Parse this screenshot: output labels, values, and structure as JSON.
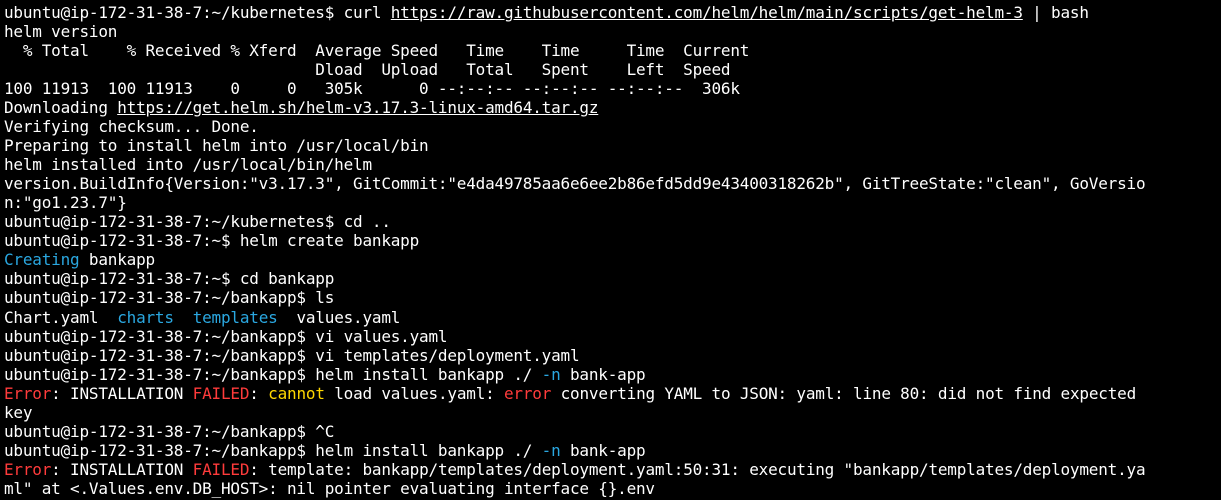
{
  "terminal": {
    "lines": [
      [
        {
          "t": "ubuntu@ip-172-31-38-7:~/kubernetes$ curl "
        },
        {
          "t": "https://raw.githubusercontent.com/helm/helm/main/scripts/get-helm-3",
          "c": "url"
        },
        {
          "t": " | bash"
        }
      ],
      [
        {
          "t": "helm version"
        }
      ],
      [
        {
          "t": "  % Total    % Received % Xferd  Average Speed   Time    Time     Time  Current"
        }
      ],
      [
        {
          "t": "                                 Dload  Upload   Total   Spent    Left  Speed"
        }
      ],
      [
        {
          "t": "100 11913  100 11913    0     0   305k      0 --:--:-- --:--:-- --:--:--  306k"
        }
      ],
      [
        {
          "t": "Downloading "
        },
        {
          "t": "https://get.helm.sh/helm-v3.17.3-linux-amd64.tar.gz",
          "c": "url"
        }
      ],
      [
        {
          "t": "Verifying checksum... Done."
        }
      ],
      [
        {
          "t": "Preparing to install helm into /usr/local/bin"
        }
      ],
      [
        {
          "t": "helm installed into /usr/local/bin/helm"
        }
      ],
      [
        {
          "t": "version.BuildInfo{Version:\"v3.17.3\", GitCommit:\"e4da49785aa6e6ee2b86efd5dd9e43400318262b\", GitTreeState:\"clean\", GoVersio"
        }
      ],
      [
        {
          "t": "n:\"go1.23.7\"}"
        }
      ],
      [
        {
          "t": "ubuntu@ip-172-31-38-7:~/kubernetes$ cd .."
        }
      ],
      [
        {
          "t": "ubuntu@ip-172-31-38-7:~$ helm create bankapp"
        }
      ],
      [
        {
          "t": "Creating",
          "c": "cyan"
        },
        {
          "t": " bankapp"
        }
      ],
      [
        {
          "t": "ubuntu@ip-172-31-38-7:~$ cd bankapp"
        }
      ],
      [
        {
          "t": "ubuntu@ip-172-31-38-7:~/bankapp$ ls"
        }
      ],
      [
        {
          "t": "Chart.yaml  "
        },
        {
          "t": "charts",
          "c": "cyan"
        },
        {
          "t": "  "
        },
        {
          "t": "templates",
          "c": "cyan"
        },
        {
          "t": "  values.yaml"
        }
      ],
      [
        {
          "t": "ubuntu@ip-172-31-38-7:~/bankapp$ vi values.yaml"
        }
      ],
      [
        {
          "t": "ubuntu@ip-172-31-38-7:~/bankapp$ vi templates/deployment.yaml"
        }
      ],
      [
        {
          "t": "ubuntu@ip-172-31-38-7:~/bankapp$ helm install bankapp ./ "
        },
        {
          "t": "-n",
          "c": "cyan"
        },
        {
          "t": " bank-app"
        }
      ],
      [
        {
          "t": "Error",
          "c": "red"
        },
        {
          "t": ": INSTALLATION "
        },
        {
          "t": "FAILED",
          "c": "red"
        },
        {
          "t": ": "
        },
        {
          "t": "cannot",
          "c": "yellow"
        },
        {
          "t": " load values.yaml: "
        },
        {
          "t": "error",
          "c": "red"
        },
        {
          "t": " converting YAML to JSON: yaml: line 80: did not find expected"
        }
      ],
      [
        {
          "t": "key"
        }
      ],
      [
        {
          "t": "ubuntu@ip-172-31-38-7:~/bankapp$ ^C"
        }
      ],
      [
        {
          "t": "ubuntu@ip-172-31-38-7:~/bankapp$ helm install bankapp ./ "
        },
        {
          "t": "-n",
          "c": "cyan"
        },
        {
          "t": " bank-app"
        }
      ],
      [
        {
          "t": "Error",
          "c": "red"
        },
        {
          "t": ": INSTALLATION "
        },
        {
          "t": "FAILED",
          "c": "red"
        },
        {
          "t": ": template: bankapp/templates/deployment.yaml:50:31: executing \"bankapp/templates/deployment.ya"
        }
      ],
      [
        {
          "t": "ml\" at <.Values.env.DB_HOST>: nil pointer evaluating interface {}.env"
        }
      ]
    ]
  },
  "colors": {
    "background": "#000000",
    "foreground": "#ffffff",
    "error_red": "#ff3b3b",
    "warn_yellow": "#ffd700",
    "dir_cyan": "#2aa7e0"
  }
}
